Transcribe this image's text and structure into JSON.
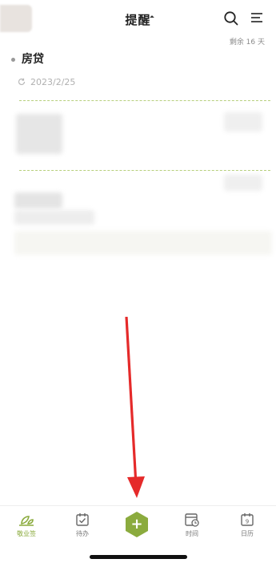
{
  "header": {
    "title": "提醒",
    "remaining_text": "剩余 16 天"
  },
  "reminder_item": {
    "title": "房贷",
    "date": "2023/2/25"
  },
  "tabs": [
    {
      "label": "敬业签",
      "icon": "sprout-icon",
      "active": true
    },
    {
      "label": "待办",
      "icon": "calendar-check-icon",
      "active": false
    },
    {
      "label": "",
      "icon": "plus-icon",
      "active": false
    },
    {
      "label": "时间",
      "icon": "calendar-clock-icon",
      "active": false
    },
    {
      "label": "日历",
      "icon": "calendar-day-icon",
      "active": false
    }
  ],
  "fab": {
    "symbol": "+"
  },
  "calendar_day_number": "9",
  "colors": {
    "accent": "#8bab3e",
    "arrow": "#e52a2a",
    "dash": "#b7cf7d"
  }
}
